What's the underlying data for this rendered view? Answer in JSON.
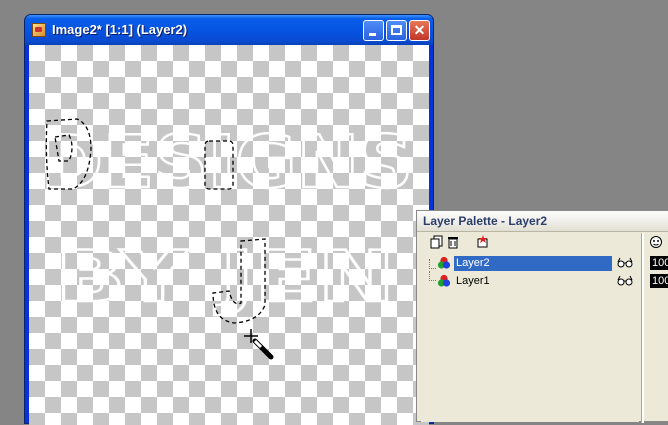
{
  "image_window": {
    "title": "Image2* [1:1] (Layer2)",
    "minimize_glyph": "",
    "maximize_glyph": "",
    "close_glyph": "✕",
    "canvas_text_line1": "DESIGNS",
    "canvas_text_line2": "BY JEN"
  },
  "layer_palette": {
    "title": "Layer Palette - Layer2",
    "layers": [
      {
        "name": "Layer2",
        "selected": true,
        "opacity": "100"
      },
      {
        "name": "Layer1",
        "selected": false,
        "opacity": "100"
      }
    ]
  },
  "colors": {
    "desktop": "#858585",
    "titlebar_blue": "#0554e3",
    "selection_blue": "#316ac5",
    "palette_bg": "#ece9d8"
  },
  "icons": [
    "app-icon",
    "minimize-icon",
    "maximize-icon",
    "close-icon",
    "new-layer-icon",
    "delete-layer-icon",
    "layer-properties-icon",
    "rgb-layer-icon",
    "visibility-glasses-icon",
    "magic-wand-cursor-icon"
  ]
}
